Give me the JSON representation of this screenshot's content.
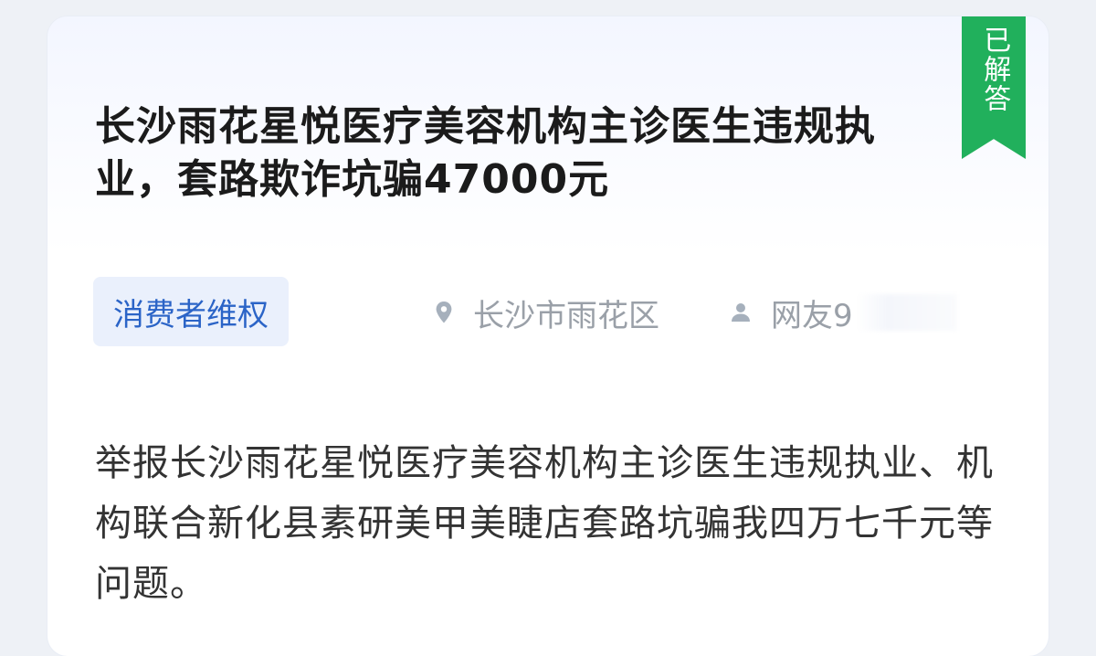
{
  "status_badge": "已解答",
  "title": "长沙雨花星悦医疗美容机构主诊医生违规执业，套路欺诈坑骗47000元",
  "category_tag": "消费者维权",
  "location": "长沙市雨花区",
  "author": "网友9",
  "body": "举报长沙雨花星悦医疗美容机构主诊医生违规执业、机构联合新化县素研美甲美睫店套路坑骗我四万七千元等问题。",
  "icons": {
    "location": "location-pin-icon",
    "author": "user-icon"
  },
  "colors": {
    "badge": "#21b05c",
    "tag_text": "#2b64c7",
    "tag_bg": "#eaf0fc",
    "meta": "#9aa0a8"
  }
}
